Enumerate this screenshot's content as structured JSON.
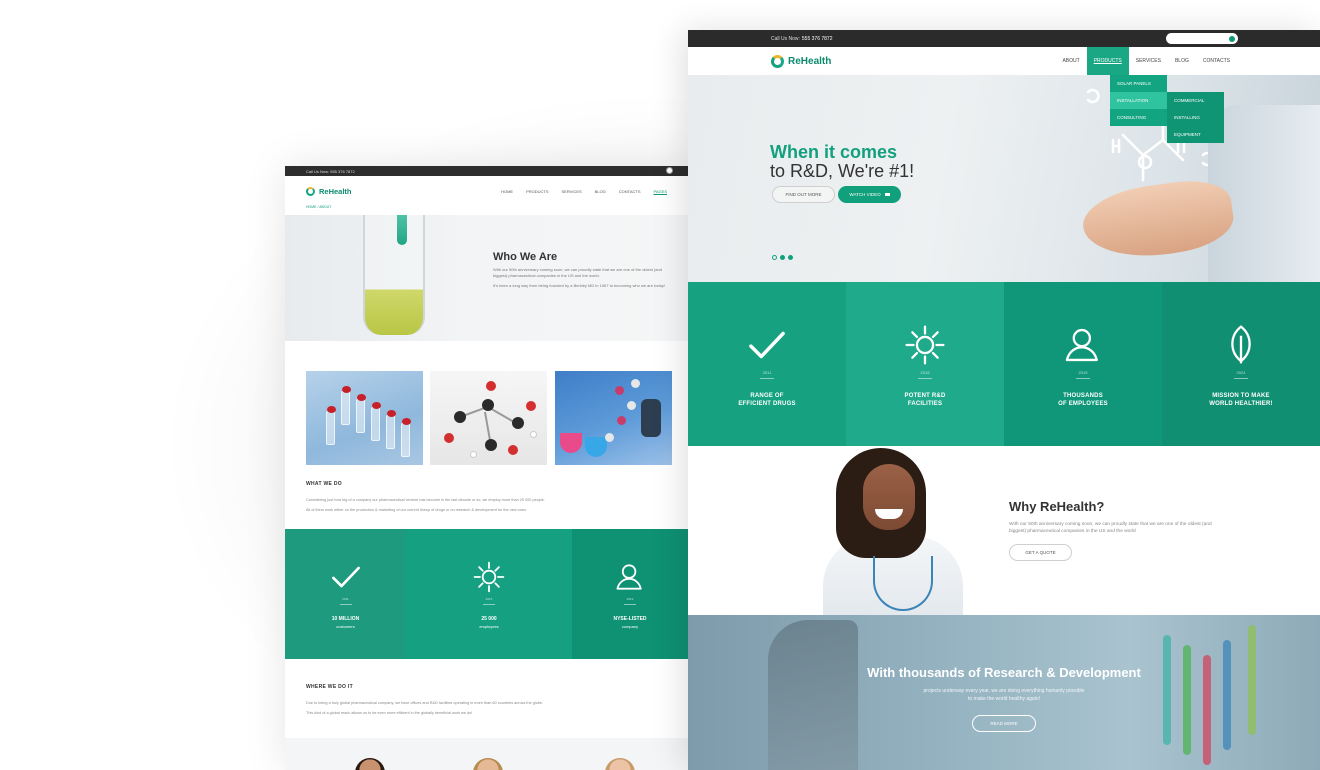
{
  "left": {
    "topbar": {
      "call_label": "Call Us Now: 555 376 7872"
    },
    "logo": "ReHealth",
    "nav": [
      "HOME",
      "PRODUCTS",
      "SERVICES",
      "BLOG",
      "CONTACTS",
      "PAGES"
    ],
    "breadcrumb": "HOME / ABOUT",
    "hero": {
      "title": "Who We Are",
      "p1": "With our 50th anniversary coming soon, we can proudly state that we are one of the oldest (and biggest) pharmaceutical companies in the US and the world.",
      "p2": "It's been a long way from being founded by a Berkley MD in 1967 to becoming who we are today!"
    },
    "what_we_do": {
      "title": "WHAT WE DO",
      "p1": "Considering just how big of a company our pharmaceutical venture has become in the last decade or so, we employ more than 25 000 people.",
      "p2": "All of them work either on the production & marketing of our current lineup of drugs or on research & development for the new ones."
    },
    "stats": [
      {
        "icon": "check-icon",
        "year": "2011",
        "value": "10 MILLION",
        "label": "customers"
      },
      {
        "icon": "sun-icon",
        "year": "2015",
        "value": "25 000",
        "label": "employees"
      },
      {
        "icon": "user-icon",
        "year": "2019",
        "value": "NYSE-LISTED",
        "label": "company"
      }
    ],
    "where_we_do_it": {
      "title": "WHERE WE DO IT",
      "p1": "Due to being a truly global pharmaceutical company, we have offices and R&D facilities operating in more than 60 countries across the globe.",
      "p2": "This kind of a global reach allows us to be even more efficient in the globally beneficial work we do!"
    }
  },
  "right": {
    "topbar": {
      "call_label": "Call Us Now:",
      "phone": "555 376 7872",
      "search_placeholder": ""
    },
    "logo": "ReHealth",
    "nav": [
      "ABOUT",
      "PRODUCTS",
      "SERVICES",
      "BLOG",
      "CONTACTS"
    ],
    "dropdown": [
      "SOLAR PANELS",
      "INSTALLATION",
      "CONSULTING"
    ],
    "submenu": [
      "COMMERCIAL",
      "INSTALLING",
      "EQUIPMENT"
    ],
    "hero": {
      "line1": "When it comes",
      "line2": "to R&D, We're #1!",
      "btn_more": "FIND OUT MORE",
      "btn_video": "WATCH VIDEO"
    },
    "features": [
      {
        "icon": "check-icon",
        "year": "2011",
        "label1": "RANGE OF",
        "label2": "EFFICIENT DRUGS"
      },
      {
        "icon": "sun-icon",
        "year": "2015",
        "label1": "POTENT R&D",
        "label2": "FACILITIES"
      },
      {
        "icon": "user-icon",
        "year": "2019",
        "label1": "THOUSANDS",
        "label2": "OF EMPLOYEES"
      },
      {
        "icon": "leaf-icon",
        "year": "2024",
        "label1": "MISSION TO MAKE",
        "label2": "WORLD HEALTHIER!"
      }
    ],
    "why": {
      "title": "Why ReHealth?",
      "text": "With our 50th anniversary coming soon, we can proudly state that we are one of the oldest (and biggest) pharmaceutical companies in the US and the world",
      "button": "GET A QUOTE"
    },
    "research": {
      "title": "With thousands of Research & Development",
      "line1": "projects underway every year, we are doing everything humanly possible",
      "line2": "to make the world healthy again!",
      "button": "READ MORE"
    }
  },
  "colors": {
    "accent": "#10a07c",
    "dark": "#2b2b2b"
  }
}
